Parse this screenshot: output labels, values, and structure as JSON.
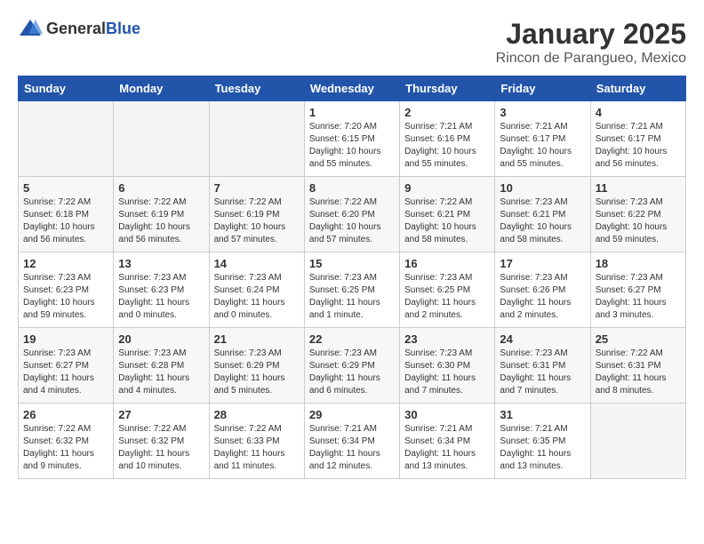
{
  "header": {
    "logo_general": "General",
    "logo_blue": "Blue",
    "month_year": "January 2025",
    "location": "Rincon de Parangueo, Mexico"
  },
  "weekdays": [
    "Sunday",
    "Monday",
    "Tuesday",
    "Wednesday",
    "Thursday",
    "Friday",
    "Saturday"
  ],
  "weeks": [
    [
      {
        "day": "",
        "info": ""
      },
      {
        "day": "",
        "info": ""
      },
      {
        "day": "",
        "info": ""
      },
      {
        "day": "1",
        "info": "Sunrise: 7:20 AM\nSunset: 6:15 PM\nDaylight: 10 hours\nand 55 minutes."
      },
      {
        "day": "2",
        "info": "Sunrise: 7:21 AM\nSunset: 6:16 PM\nDaylight: 10 hours\nand 55 minutes."
      },
      {
        "day": "3",
        "info": "Sunrise: 7:21 AM\nSunset: 6:17 PM\nDaylight: 10 hours\nand 55 minutes."
      },
      {
        "day": "4",
        "info": "Sunrise: 7:21 AM\nSunset: 6:17 PM\nDaylight: 10 hours\nand 56 minutes."
      }
    ],
    [
      {
        "day": "5",
        "info": "Sunrise: 7:22 AM\nSunset: 6:18 PM\nDaylight: 10 hours\nand 56 minutes."
      },
      {
        "day": "6",
        "info": "Sunrise: 7:22 AM\nSunset: 6:19 PM\nDaylight: 10 hours\nand 56 minutes."
      },
      {
        "day": "7",
        "info": "Sunrise: 7:22 AM\nSunset: 6:19 PM\nDaylight: 10 hours\nand 57 minutes."
      },
      {
        "day": "8",
        "info": "Sunrise: 7:22 AM\nSunset: 6:20 PM\nDaylight: 10 hours\nand 57 minutes."
      },
      {
        "day": "9",
        "info": "Sunrise: 7:22 AM\nSunset: 6:21 PM\nDaylight: 10 hours\nand 58 minutes."
      },
      {
        "day": "10",
        "info": "Sunrise: 7:23 AM\nSunset: 6:21 PM\nDaylight: 10 hours\nand 58 minutes."
      },
      {
        "day": "11",
        "info": "Sunrise: 7:23 AM\nSunset: 6:22 PM\nDaylight: 10 hours\nand 59 minutes."
      }
    ],
    [
      {
        "day": "12",
        "info": "Sunrise: 7:23 AM\nSunset: 6:23 PM\nDaylight: 10 hours\nand 59 minutes."
      },
      {
        "day": "13",
        "info": "Sunrise: 7:23 AM\nSunset: 6:23 PM\nDaylight: 11 hours\nand 0 minutes."
      },
      {
        "day": "14",
        "info": "Sunrise: 7:23 AM\nSunset: 6:24 PM\nDaylight: 11 hours\nand 0 minutes."
      },
      {
        "day": "15",
        "info": "Sunrise: 7:23 AM\nSunset: 6:25 PM\nDaylight: 11 hours\nand 1 minute."
      },
      {
        "day": "16",
        "info": "Sunrise: 7:23 AM\nSunset: 6:25 PM\nDaylight: 11 hours\nand 2 minutes."
      },
      {
        "day": "17",
        "info": "Sunrise: 7:23 AM\nSunset: 6:26 PM\nDaylight: 11 hours\nand 2 minutes."
      },
      {
        "day": "18",
        "info": "Sunrise: 7:23 AM\nSunset: 6:27 PM\nDaylight: 11 hours\nand 3 minutes."
      }
    ],
    [
      {
        "day": "19",
        "info": "Sunrise: 7:23 AM\nSunset: 6:27 PM\nDaylight: 11 hours\nand 4 minutes."
      },
      {
        "day": "20",
        "info": "Sunrise: 7:23 AM\nSunset: 6:28 PM\nDaylight: 11 hours\nand 4 minutes."
      },
      {
        "day": "21",
        "info": "Sunrise: 7:23 AM\nSunset: 6:29 PM\nDaylight: 11 hours\nand 5 minutes."
      },
      {
        "day": "22",
        "info": "Sunrise: 7:23 AM\nSunset: 6:29 PM\nDaylight: 11 hours\nand 6 minutes."
      },
      {
        "day": "23",
        "info": "Sunrise: 7:23 AM\nSunset: 6:30 PM\nDaylight: 11 hours\nand 7 minutes."
      },
      {
        "day": "24",
        "info": "Sunrise: 7:23 AM\nSunset: 6:31 PM\nDaylight: 11 hours\nand 7 minutes."
      },
      {
        "day": "25",
        "info": "Sunrise: 7:22 AM\nSunset: 6:31 PM\nDaylight: 11 hours\nand 8 minutes."
      }
    ],
    [
      {
        "day": "26",
        "info": "Sunrise: 7:22 AM\nSunset: 6:32 PM\nDaylight: 11 hours\nand 9 minutes."
      },
      {
        "day": "27",
        "info": "Sunrise: 7:22 AM\nSunset: 6:32 PM\nDaylight: 11 hours\nand 10 minutes."
      },
      {
        "day": "28",
        "info": "Sunrise: 7:22 AM\nSunset: 6:33 PM\nDaylight: 11 hours\nand 11 minutes."
      },
      {
        "day": "29",
        "info": "Sunrise: 7:21 AM\nSunset: 6:34 PM\nDaylight: 11 hours\nand 12 minutes."
      },
      {
        "day": "30",
        "info": "Sunrise: 7:21 AM\nSunset: 6:34 PM\nDaylight: 11 hours\nand 13 minutes."
      },
      {
        "day": "31",
        "info": "Sunrise: 7:21 AM\nSunset: 6:35 PM\nDaylight: 11 hours\nand 13 minutes."
      },
      {
        "day": "",
        "info": ""
      }
    ]
  ]
}
